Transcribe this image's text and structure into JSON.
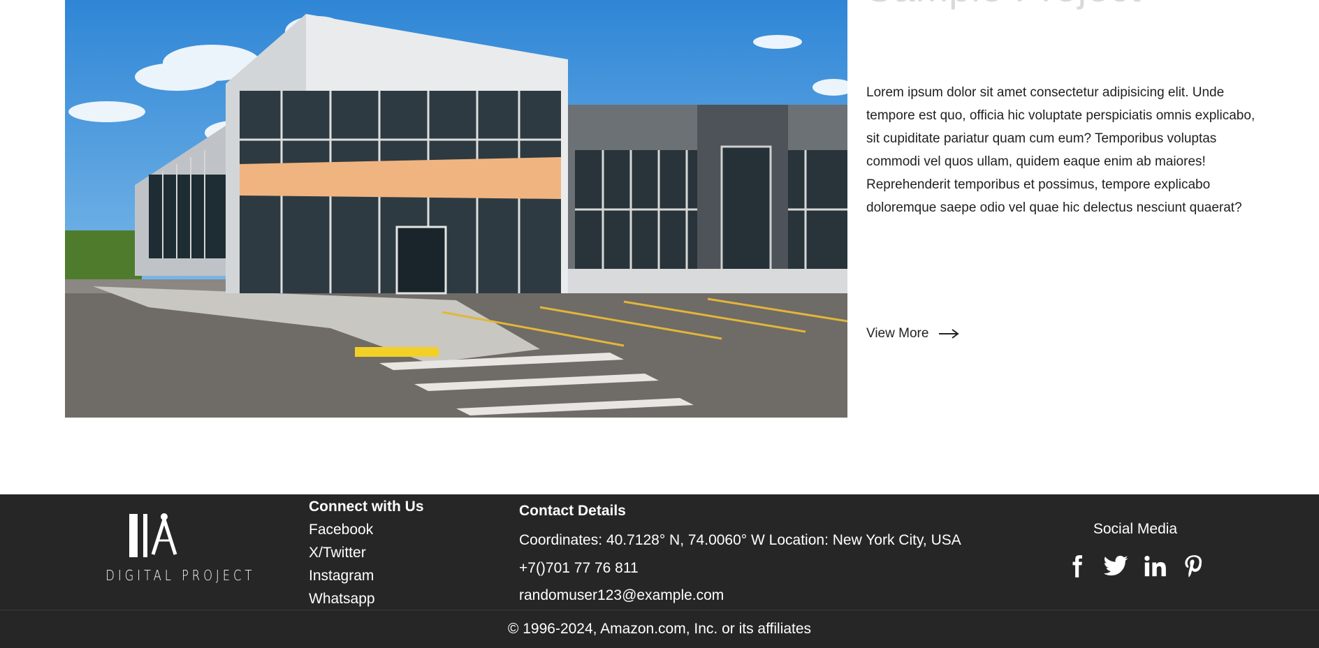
{
  "project": {
    "title": "Sample Project",
    "description": "Lorem ipsum dolor sit amet consectetur adipisicing elit. Unde tempore est quo, officia hic voluptate perspiciatis omnis explicabo, sit cupiditate pariatur quam cum eum? Temporibus voluptas commodi vel quos ullam, quidem eaque enim ab maiores! Reprehenderit temporibus et possimus, tempore explicabo doloremque saepe odio vel quae hic delectus nesciunt quaerat?",
    "view_more_label": "View More"
  },
  "footer": {
    "logo_text": "DIGITAL PROJECT",
    "connect": {
      "title": "Connect with Us",
      "links": [
        "Facebook",
        "X/Twitter",
        "Instagram",
        "Whatsapp"
      ]
    },
    "contact": {
      "title": "Contact Details",
      "coordinates": "Coordinates: 40.7128° N, 74.0060° W Location: New York City, USA",
      "phone": "+7()701 77 76 811",
      "email": "randomuser123@example.com"
    },
    "social": {
      "title": "Social Media",
      "icons": [
        "facebook-icon",
        "twitter-icon",
        "linkedin-icon",
        "pinterest-icon"
      ]
    },
    "copyright": "© 1996-2024, Amazon.com, Inc. or its affiliates"
  },
  "colors": {
    "footer_bg": "#262626",
    "text_dark": "#1f1f1f",
    "title_light": "#d9d9d9"
  }
}
